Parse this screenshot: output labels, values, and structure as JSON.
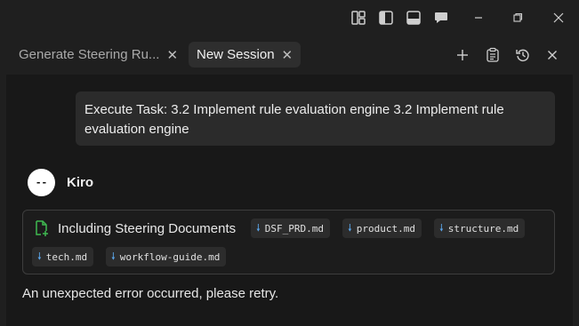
{
  "window": {
    "controls": [
      "layout-panels-icon",
      "toggle-sidebar-icon",
      "toggle-bottom-panel-icon",
      "chat-icon",
      "minimize-icon",
      "restore-icon",
      "close-icon"
    ]
  },
  "tabs": [
    {
      "label": "Generate Steering Ru...",
      "active": false
    },
    {
      "label": "New Session",
      "active": true
    }
  ],
  "tab_actions": [
    "add-icon",
    "task-list-icon",
    "history-icon",
    "close-icon"
  ],
  "chat": {
    "user_message": "Execute Task: 3.2 Implement rule evaluation engine 3.2 Implement rule evaluation engine",
    "agent": {
      "name": "Kiro",
      "avatar_glyph": "--"
    },
    "steering": {
      "title": "Including Steering Documents",
      "documents": [
        "DSF_PRD.md",
        "product.md",
        "structure.md",
        "tech.md",
        "workflow-guide.md"
      ]
    },
    "error_message": "An unexpected error occurred, please retry."
  },
  "colors": {
    "background": "#1f1f1f",
    "panel": "#181818",
    "active_tab": "#2e2e2e",
    "download_accent": "#5aa4e8",
    "steering_icon": "#3fb950"
  }
}
